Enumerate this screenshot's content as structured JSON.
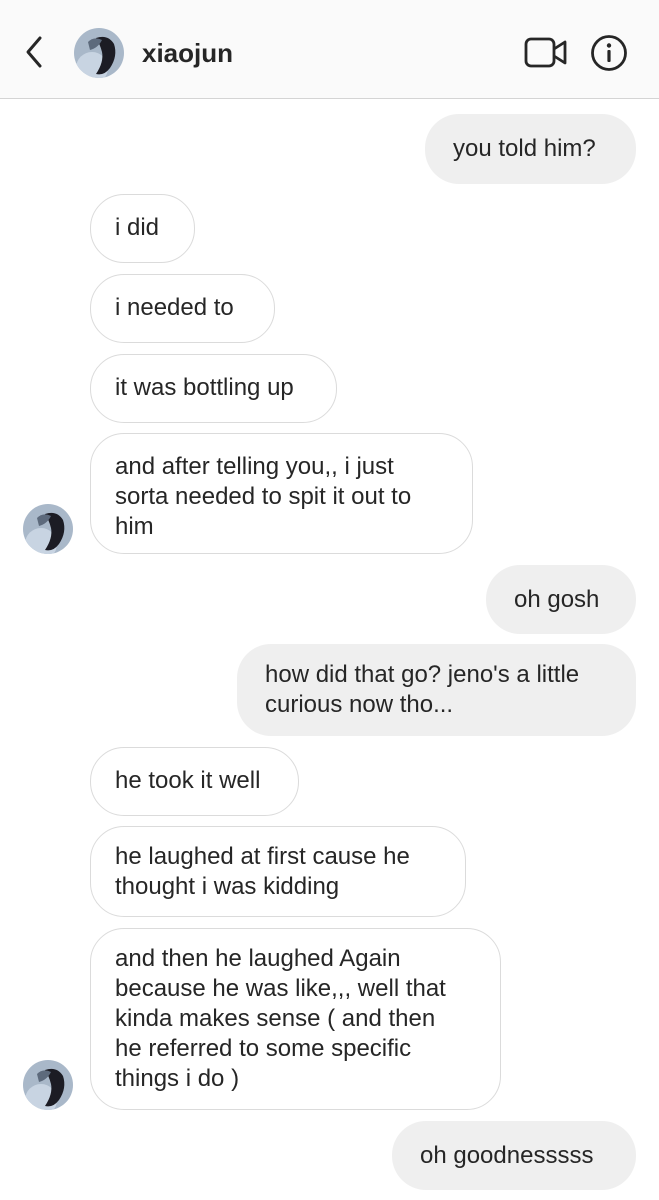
{
  "header": {
    "contact_name": "xiaojun",
    "back_icon": "chevron-left-icon",
    "video_icon": "video-camera-icon",
    "info_icon": "info-icon"
  },
  "messages": [
    {
      "sender": "me",
      "text": "you told him?"
    },
    {
      "sender": "them",
      "text": "i did"
    },
    {
      "sender": "them",
      "text": "i needed to"
    },
    {
      "sender": "them",
      "text": "it was bottling up"
    },
    {
      "sender": "them",
      "text": "and after telling you,, i just\nsorta needed to spit it out to\nhim"
    },
    {
      "sender": "me",
      "text": "oh gosh"
    },
    {
      "sender": "me",
      "text": "how did that go? jeno's a little\ncurious now tho..."
    },
    {
      "sender": "them",
      "text": "he took it well"
    },
    {
      "sender": "them",
      "text": "he laughed at first cause he\nthought i was kidding"
    },
    {
      "sender": "them",
      "text": "and then he laughed Again\nbecause he was like,,, well that\nkinda makes sense ( and then\nhe referred to some specific\nthings i do )"
    },
    {
      "sender": "me",
      "text": "oh goodnesssss"
    }
  ],
  "colors": {
    "outgoing_bubble": "#efefef",
    "incoming_border": "#dbdbdb",
    "header_bg": "#fafafa",
    "text": "#262626"
  }
}
